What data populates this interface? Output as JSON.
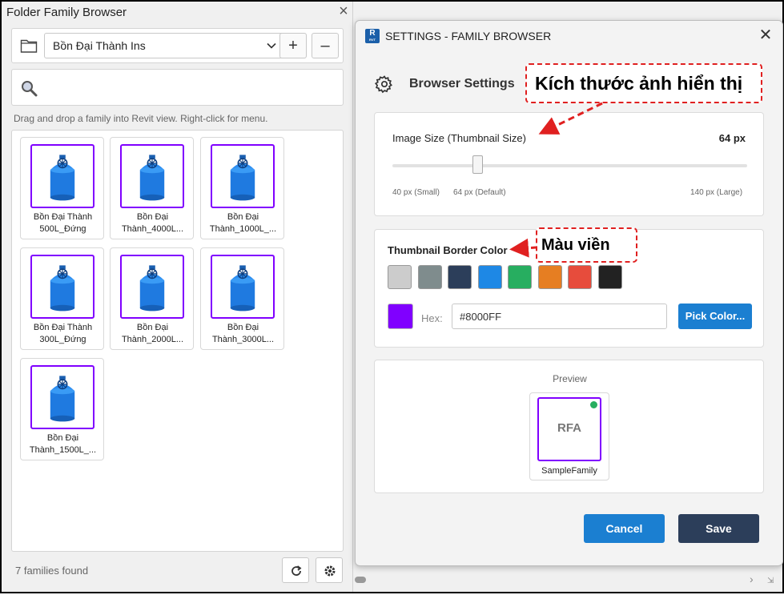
{
  "left_panel": {
    "title": "Folder Family Browser",
    "close_icon": "×",
    "folder_select_value": "Bồn Đại Thành Ins",
    "add_label": "+",
    "remove_label": "–",
    "search_placeholder": "",
    "hint": "Drag and drop a family into Revit view. Right-click for menu.",
    "families": [
      {
        "line1": "Bồn Đại Thành",
        "line2": "500L_Đứng"
      },
      {
        "line1": "Bồn Đại",
        "line2": "Thành_4000L..."
      },
      {
        "line1": "Bồn Đại",
        "line2": "Thành_1000L_..."
      },
      {
        "line1": "Bồn Đại Thành",
        "line2": "300L_Đứng"
      },
      {
        "line1": "Bồn Đại",
        "line2": "Thành_2000L..."
      },
      {
        "line1": "Bồn Đại",
        "line2": "Thành_3000L..."
      },
      {
        "line1": "Bồn Đại",
        "line2": "Thành_1500L_..."
      }
    ],
    "status": "7 families found"
  },
  "dialog": {
    "logo_letter": "R",
    "logo_sub": "RVT",
    "title": "SETTINGS - FAMILY BROWSER",
    "close_icon": "✕",
    "heading": "Browser Settings",
    "image_size": {
      "label": "Image Size (Thumbnail Size)",
      "value_text": "64 px",
      "value": 64,
      "min": 40,
      "max": 140,
      "tick_min": "40 px (Small)",
      "tick_default": "64 px (Default)",
      "tick_max": "140 px (Large)"
    },
    "border_color": {
      "label": "Thumbnail Border Color",
      "swatches": [
        "#cccccc",
        "#7f8c8d",
        "#2c3e5a",
        "#1e88e5",
        "#27ae60",
        "#e67e22",
        "#e74c3c",
        "#222222"
      ],
      "current": "#8000ff",
      "hex_label": "Hex:",
      "hex_value": "#8000FF",
      "pick_label": "Pick Color..."
    },
    "preview": {
      "label": "Preview",
      "thumb_text": "RFA",
      "name": "SampleFamily"
    },
    "cancel_label": "Cancel",
    "save_label": "Save"
  },
  "annotations": {
    "size_callout": "Kích thước ảnh hiển thị",
    "color_callout": "Màu viền",
    "accent": "#e02020"
  }
}
